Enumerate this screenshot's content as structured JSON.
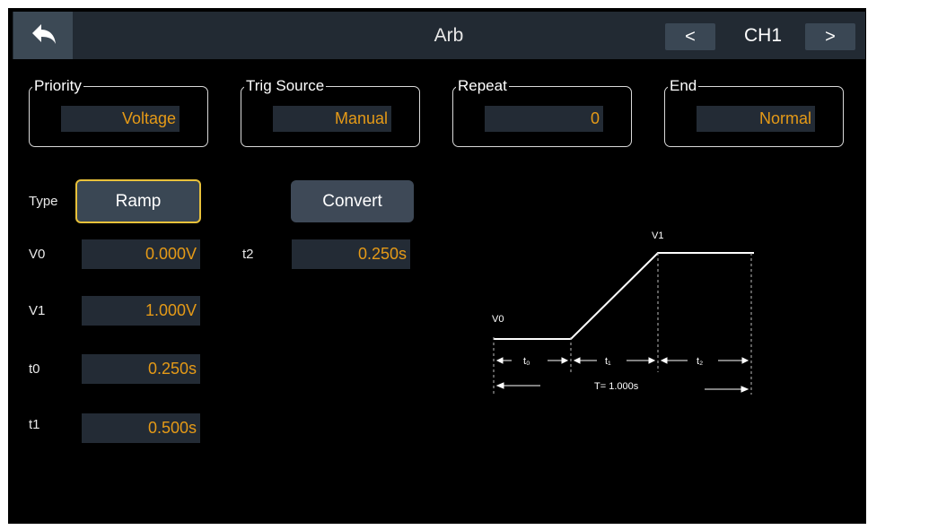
{
  "header": {
    "title": "Arb",
    "channel": "CH1",
    "prev_label": "<",
    "next_label": ">"
  },
  "settings": {
    "priority": {
      "label": "Priority",
      "value": "Voltage"
    },
    "trig_source": {
      "label": "Trig Source",
      "value": "Manual"
    },
    "repeat": {
      "label": "Repeat",
      "value": "0"
    },
    "end": {
      "label": "End",
      "value": "Normal"
    }
  },
  "params": {
    "type_label": "Type",
    "type_value": "Ramp",
    "convert_label": "Convert",
    "v0": {
      "label": "V0",
      "value": "0.000V"
    },
    "v1": {
      "label": "V1",
      "value": "1.000V"
    },
    "t0": {
      "label": "t0",
      "value": "0.250s"
    },
    "t1": {
      "label": "t1",
      "value": "0.500s"
    },
    "t2": {
      "label": "t2",
      "value": "0.250s"
    }
  },
  "diagram": {
    "v0_label": "V0",
    "v1_label": "V1",
    "t0_label": "t₀",
    "t1_label": "t₁",
    "t2_label": "t₂",
    "period_label": "T= 1.000s"
  },
  "colors": {
    "value": "#e59a17",
    "field_bg": "#232b35",
    "header_bg": "#222a33",
    "button_bg": "#3a4754",
    "highlight_border": "#e8c13a"
  },
  "icons": {
    "back": "back-arrow-icon"
  }
}
